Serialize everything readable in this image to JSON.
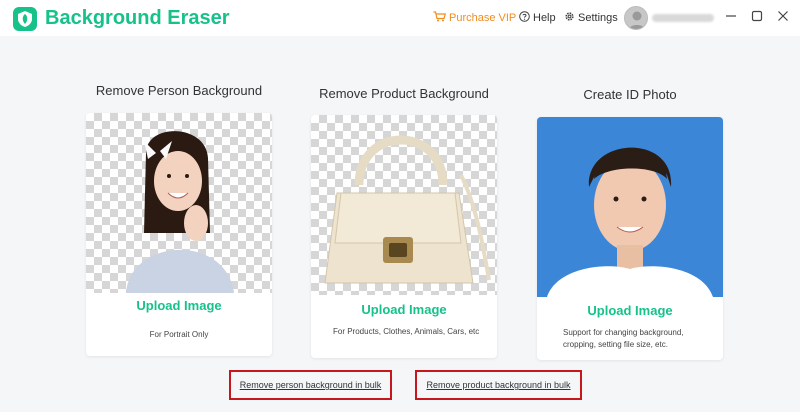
{
  "app": {
    "title": "Background Eraser"
  },
  "header": {
    "purchase_label": "Purchase VIP",
    "help_label": "Help",
    "settings_label": "Settings"
  },
  "cards": [
    {
      "title": "Remove Person Background",
      "upload_label": "Upload Image",
      "description": "For Portrait Only"
    },
    {
      "title": "Remove Product Background",
      "upload_label": "Upload Image",
      "description": "For Products, Clothes, Animals, Cars, etc"
    },
    {
      "title": "Create ID Photo",
      "upload_label": "Upload Image",
      "description": "Support for changing background, cropping, setting file size, etc."
    }
  ],
  "bulk_links": {
    "person": "Remove person background in bulk",
    "product": "Remove product background in bulk"
  },
  "colors": {
    "brand": "#16c28a",
    "purchase": "#f08c1e",
    "id_photo_background": "#3c86d8",
    "highlight": "#c8161d"
  },
  "icons": {
    "logo": "shield-leaf-icon",
    "purchase": "cart-icon",
    "help": "question-circle-icon",
    "settings": "gear-icon",
    "minimize": "minimize-icon",
    "maximize": "maximize-icon",
    "close": "close-icon"
  }
}
